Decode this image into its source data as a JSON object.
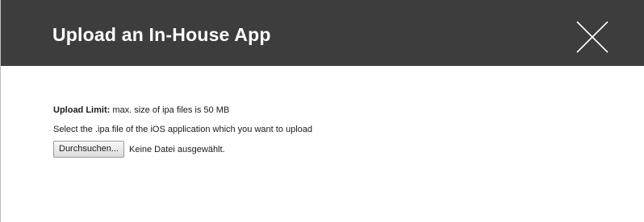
{
  "dialog": {
    "title": "Upload an In-House App",
    "close_icon": "close-icon"
  },
  "upload": {
    "limit_label": "Upload Limit:",
    "limit_text": " max. size of ipa files is 50 MB",
    "instruction": "Select the .ipa file of the iOS application which you want to upload",
    "browse_label": "Durchsuchen...",
    "file_status": "Keine Datei ausgewählt."
  },
  "colors": {
    "header_background": "#3d3d3d",
    "header_text": "#ffffff"
  }
}
